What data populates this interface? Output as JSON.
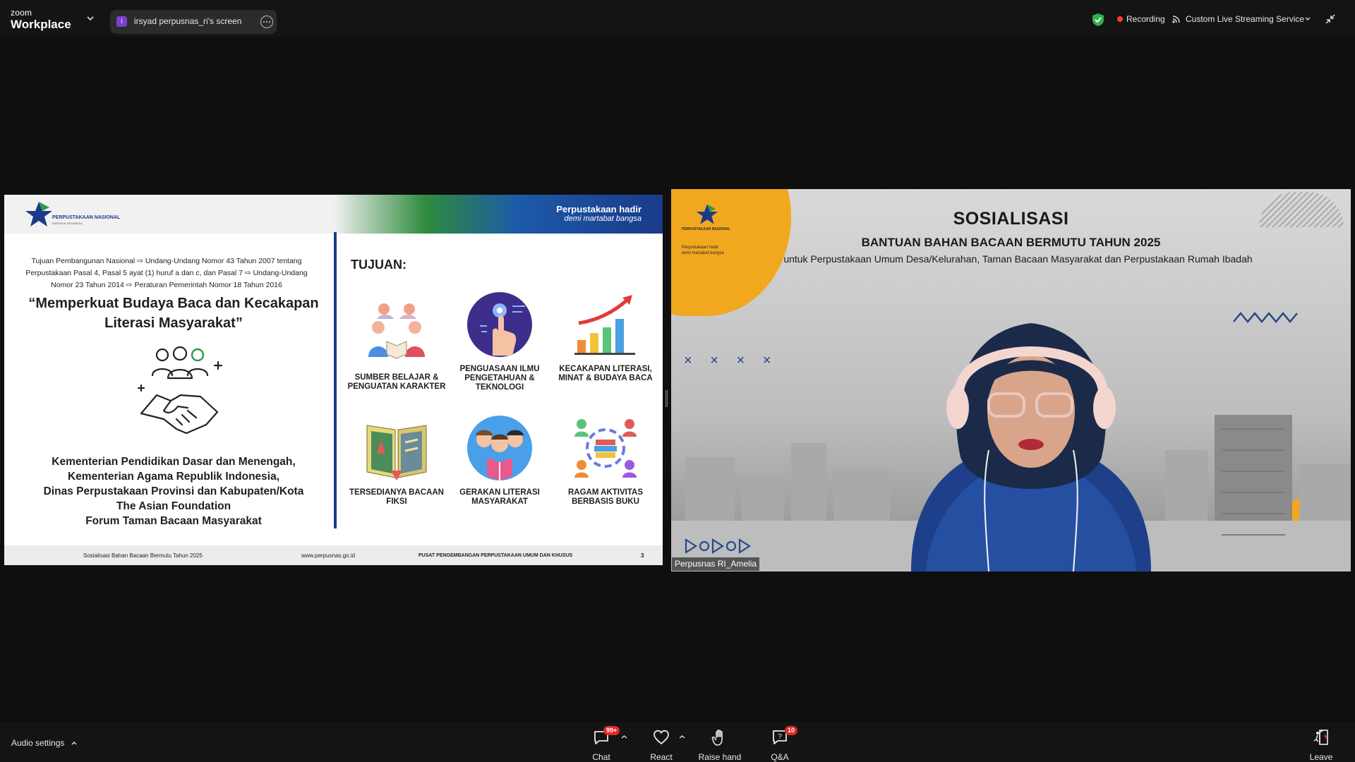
{
  "app": {
    "brand_top": "zoom",
    "brand_bottom": "Workplace"
  },
  "share": {
    "badge_letter": "i",
    "label": "irsyad perpusnas_ri's screen"
  },
  "status": {
    "recording": "Recording",
    "streaming": "Custom Live Streaming Service"
  },
  "slide": {
    "header": {
      "org_name": "PERPUSTAKAAN NASIONAL",
      "org_sub": "REPUBLIK INDONESIA",
      "tagline_1": "Perpustakaan hadir",
      "tagline_2": "demi martabat bangsa"
    },
    "legal_lines": [
      "Tujuan Pembangunan Nasional ⇨ Undang-Undang Nomor 43 Tahun 2007 tentang",
      "Perpustakaan Pasal 4, Pasal 5 ayat (1) huruf a dan c, dan Pasal 7 ⇨ Undang-Undang",
      "Nomor 23 Tahun 2014 ⇨ Peraturan Pemerintah Nomor 18 Tahun 2016"
    ],
    "quote_1": "“Memperkuat Budaya Baca dan Kecakapan",
    "quote_2": "Literasi Masyarakat”",
    "partners": [
      "Kementerian Pendidikan Dasar dan Menengah,",
      "Kementerian Agama Republik Indonesia,",
      "Dinas Perpustakaan Provinsi dan Kabupaten/Kota",
      "The Asian Foundation",
      "Forum Taman Bacaan Masyarakat"
    ],
    "tujuan_heading": "TUJUAN:",
    "goals": [
      {
        "line1": "SUMBER BELAJAR &",
        "line2": "PENGUATAN KARAKTER",
        "line3": ""
      },
      {
        "line1": "PENGUASAAN ILMU",
        "line2": "PENGETAHUAN &",
        "line3": "TEKNOLOGI"
      },
      {
        "line1": "KECAKAPAN LITERASI,",
        "line2": "MINAT & BUDAYA BACA",
        "line3": ""
      },
      {
        "line1": "TERSEDIANYA BACAAN",
        "line2": "FIKSI",
        "line3": ""
      },
      {
        "line1": "GERAKAN LITERASI",
        "line2": "MASYARAKAT",
        "line3": ""
      },
      {
        "line1": "RAGAM AKTIVITAS",
        "line2": "BERBASIS BUKU",
        "line3": ""
      }
    ],
    "footer": {
      "left": "Sosialisasi Bahan Bacaan Bermutu Tahun 2025",
      "site": "www.perpusnas.go.id",
      "center": "PUSAT PENGEMBANGAN PERPUSTAKAAN UMUM DAN KHUSUS",
      "page": "3"
    }
  },
  "video": {
    "logo_org": "PERPUSTAKAAN NASIONAL",
    "logo_tag_1": "Perpustakaan hadir",
    "logo_tag_2": "demi martabat bangsa",
    "title": "SOSIALISASI",
    "subtitle": "BANTUAN BAHAN BACAAN BERMUTU TAHUN 2025",
    "subline": "untuk Perpustakaan Umum Desa/Kelurahan, Taman Bacaan Masyarakat dan Perpustakaan Rumah Ibadah",
    "crosses": "× × × ×",
    "participant_name": "Perpusnas RI_Amelia"
  },
  "toolbar": {
    "audio_settings": "Audio settings",
    "chat": "Chat",
    "chat_badge": "99+",
    "react": "React",
    "raise_hand": "Raise hand",
    "qa": "Q&A",
    "qa_badge": "10",
    "leave": "Leave"
  },
  "colors": {
    "bg": "#0f0f0f",
    "bar": "#141414",
    "recording_dot": "#ff3b3b",
    "security_green": "#2fb34a",
    "slide_navy": "#1b3b8a",
    "video_orange": "#f1a81f",
    "badge_red": "#e02828"
  },
  "icons": [
    "chevron-down-icon",
    "more-icon",
    "shield-check-icon",
    "streaming-icon",
    "exit-fullscreen-icon",
    "chat-icon",
    "heart-icon",
    "hand-icon",
    "qa-icon",
    "leave-icon"
  ]
}
